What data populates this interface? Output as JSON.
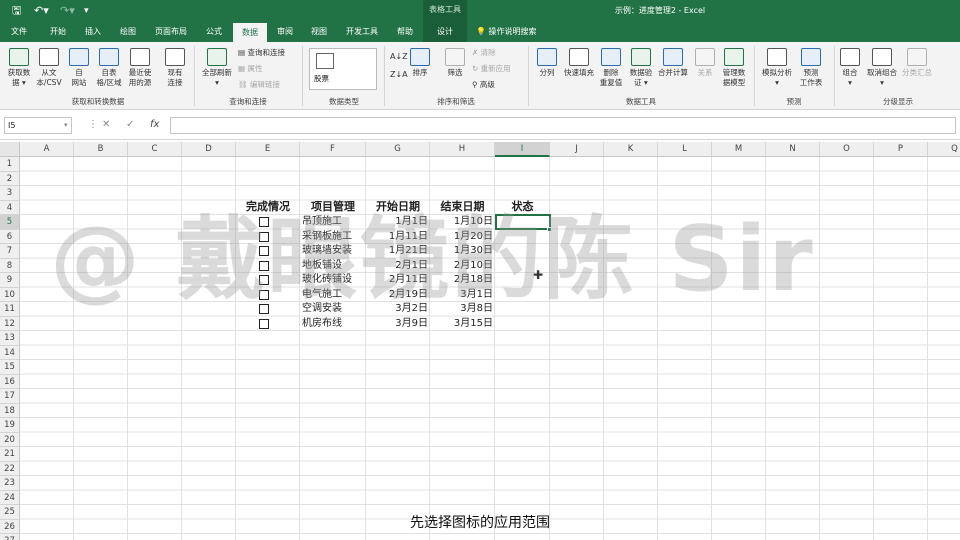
{
  "window": {
    "context_group": "表格工具",
    "title": "示例：进度管理2  -  Excel"
  },
  "quick_access": {
    "save_icon": "save-icon",
    "undo_icon": "undo-icon",
    "redo_icon": "redo-icon",
    "customize_icon": "customize-icon"
  },
  "tabs": [
    "文件",
    "开始",
    "插入",
    "绘图",
    "页面布局",
    "公式",
    "数据",
    "审阅",
    "视图",
    "开发工具",
    "帮助",
    "设计"
  ],
  "active_tab": "数据",
  "tell_me": "操作说明搜索",
  "ribbon": {
    "get_transform": {
      "buttons": [
        "获取数\n据 ▾",
        "从文\n本/CSV",
        "自\n网站",
        "自表\n格/区域",
        "最近使\n用的源",
        "现有\n连接"
      ],
      "group": "获取和转换数据"
    },
    "queries": {
      "refresh_all": "全部刷新\n▾",
      "items": [
        "查询和连接",
        "属性",
        "编辑链接"
      ],
      "group": "查询和连接"
    },
    "data_types": {
      "value": "股票",
      "group": "数据类型"
    },
    "sort_filter": {
      "sort": "排序",
      "filter": "筛选",
      "items": [
        "清除",
        "重新应用",
        "高级"
      ],
      "group": "排序和筛选"
    },
    "data_tools": {
      "buttons": [
        "分列",
        "快速填充",
        "删除\n重复值",
        "数据验\n证 ▾",
        "合并计算",
        "关系",
        "管理数\n据模型"
      ],
      "group": "数据工具"
    },
    "forecast": {
      "buttons": [
        "模拟分析\n▾",
        "预测\n工作表"
      ],
      "group": "预测"
    },
    "outline": {
      "buttons": [
        "组合\n▾",
        "取消组合\n▾",
        "分类汇总"
      ],
      "group": "分级显示"
    }
  },
  "formula_bar": {
    "name_box": "I5",
    "cancel": "✕",
    "enter": "✓",
    "fx": "fx",
    "formula": ""
  },
  "columns": [
    "A",
    "B",
    "C",
    "D",
    "E",
    "F",
    "G",
    "H",
    "I",
    "J",
    "K",
    "L",
    "M",
    "N",
    "O",
    "P",
    "Q"
  ],
  "selected_column": "I",
  "rows": [
    "1",
    "2",
    "3",
    "4",
    "5",
    "6",
    "7",
    "8",
    "9",
    "10",
    "11",
    "12",
    "13",
    "14",
    "15",
    "16",
    "17",
    "18",
    "19",
    "20",
    "21",
    "22",
    "23",
    "24",
    "25",
    "26",
    "27"
  ],
  "selected_row": "5",
  "table": {
    "headers": [
      "完成情况",
      "项目管理",
      "开始日期",
      "结束日期",
      "状态"
    ],
    "rows": [
      {
        "task": "吊顶施工",
        "start": "1月1日",
        "end": "1月10日"
      },
      {
        "task": "采钢板施工",
        "start": "1月11日",
        "end": "1月20日"
      },
      {
        "task": "玻璃墙安装",
        "start": "1月21日",
        "end": "1月30日"
      },
      {
        "task": "地板铺设",
        "start": "2月1日",
        "end": "2月10日"
      },
      {
        "task": "玻化砖铺设",
        "start": "2月11日",
        "end": "2月18日"
      },
      {
        "task": "电气施工",
        "start": "2月19日",
        "end": "3月1日"
      },
      {
        "task": "空调安装",
        "start": "3月2日",
        "end": "3月8日"
      },
      {
        "task": "机房布线",
        "start": "3月9日",
        "end": "3月15日"
      }
    ]
  },
  "watermark": "@ 戴眼镜的陈 Sir",
  "subtitle": "先选择图标的应用范围",
  "colors": {
    "accent": "#217346",
    "context": "#1a5e39"
  }
}
